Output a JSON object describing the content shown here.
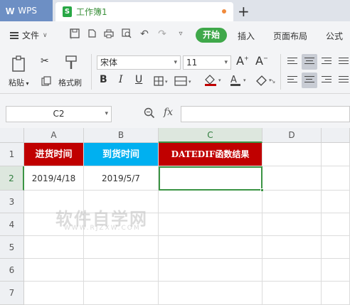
{
  "titlebar": {
    "app_name": "WPS",
    "doc_name": "工作簿1",
    "new_tab": "+"
  },
  "menubar": {
    "file": "文件",
    "start": "开始",
    "tabs": [
      "插入",
      "页面布局",
      "公式"
    ]
  },
  "ribbon": {
    "paste": "粘贴",
    "format_painter": "格式刷",
    "font_name": "宋体",
    "font_size": "11"
  },
  "formula_bar": {
    "name_box": "C2",
    "fx": "fx",
    "formula": ""
  },
  "sheet": {
    "columns": [
      "A",
      "B",
      "C",
      "D"
    ],
    "rows": [
      "1",
      "2",
      "3",
      "4",
      "5",
      "6",
      "7"
    ],
    "header_cells": {
      "a1": "进货时间",
      "b1": "到货时间",
      "c1": "DATEDIF函数结果"
    },
    "a2": "2019/4/18",
    "b2": "2019/5/7",
    "c2": "",
    "header_colors": {
      "a1": "#c00000",
      "b1": "#00b0f0",
      "c1": "#c00000"
    }
  },
  "watermark": {
    "main": "软件自学网",
    "sub": "WWW.RJZXW.COM"
  }
}
